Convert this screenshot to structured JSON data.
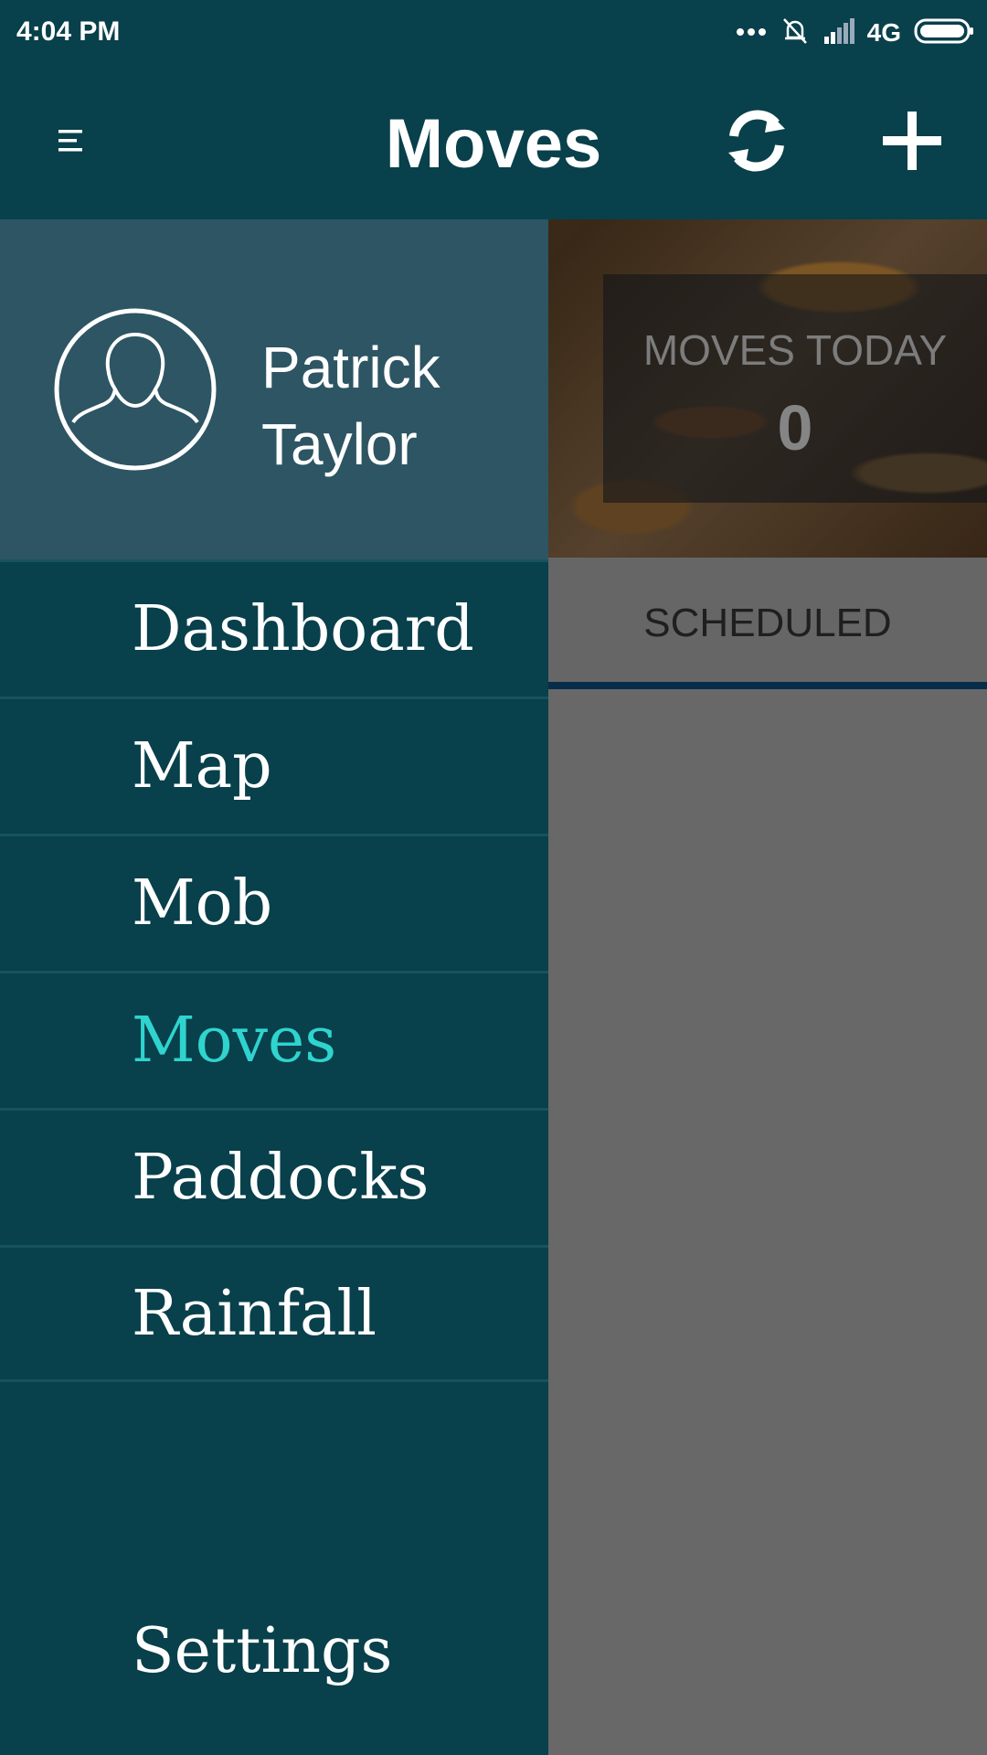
{
  "status_bar": {
    "time": "4:04 PM",
    "network": "4G",
    "icons": [
      "more-dots-icon",
      "notifications-off-icon",
      "signal-icon",
      "battery-icon"
    ]
  },
  "app_bar": {
    "title": "Moves",
    "icons": [
      "menu-icon",
      "refresh-icon",
      "add-icon"
    ]
  },
  "drawer": {
    "user": {
      "name": "Patrick Taylor",
      "avatar_icon": "person-silhouette-icon"
    },
    "items": [
      {
        "label": "Dashboard",
        "active": false
      },
      {
        "label": "Map",
        "active": false
      },
      {
        "label": "Mob",
        "active": false
      },
      {
        "label": "Moves",
        "active": true
      },
      {
        "label": "Paddocks",
        "active": false
      },
      {
        "label": "Rainfall",
        "active": false
      }
    ],
    "settings_label": "Settings"
  },
  "background": {
    "stat": {
      "label": "MOVES TODAY",
      "value": "0"
    },
    "tab": {
      "label": "SCHEDULED"
    }
  },
  "colors": {
    "primary": "#08404b",
    "drawer_header": "#2d5563",
    "active_item": "#2fd4cf",
    "tab_indicator": "#0c4a7a"
  }
}
